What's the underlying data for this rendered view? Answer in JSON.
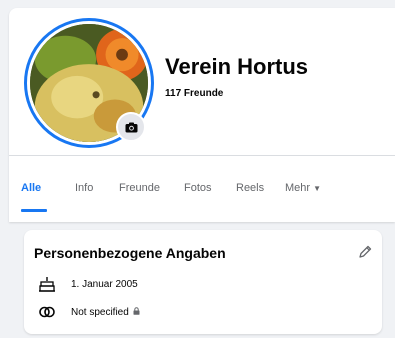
{
  "profile": {
    "name": "Verein Hortus",
    "friends": "117 Freunde"
  },
  "tabs": [
    {
      "label": "Alle",
      "active": true
    },
    {
      "label": "Info"
    },
    {
      "label": "Freunde"
    },
    {
      "label": "Fotos"
    },
    {
      "label": "Reels"
    },
    {
      "label": "Mehr"
    }
  ],
  "details": {
    "title": "Personenbezogene Angaben",
    "birthday": "1. Januar 2005",
    "relationship": "Not specified"
  },
  "icons": {
    "camera": "camera-icon",
    "edit": "pencil-icon",
    "birthday": "birthday-cake-icon",
    "relationship": "rings-icon",
    "privacy": "lock-icon",
    "more": "caret-down-icon"
  },
  "colors": {
    "accent": "#1877f2",
    "text": "#050505",
    "muted": "#65676b",
    "background": "#f0f2f5"
  }
}
